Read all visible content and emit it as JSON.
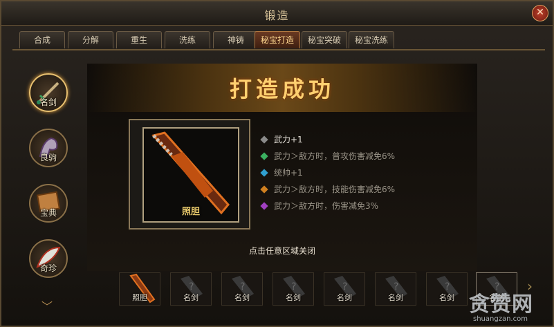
{
  "window": {
    "title": "锻造",
    "close_glyph": "✕"
  },
  "tabs": [
    {
      "label": "合成",
      "active": false
    },
    {
      "label": "分解",
      "active": false
    },
    {
      "label": "重生",
      "active": false
    },
    {
      "label": "洗练",
      "active": false
    },
    {
      "label": "神铸",
      "active": false
    },
    {
      "label": "秘宝打造",
      "active": true
    },
    {
      "label": "秘宝突破",
      "active": false
    },
    {
      "label": "秘宝洗练",
      "active": false
    }
  ],
  "sidebar": {
    "items": [
      {
        "label": "名剑",
        "icon": "sword-icon",
        "active": true
      },
      {
        "label": "良驹",
        "icon": "horse-icon",
        "active": false
      },
      {
        "label": "宝典",
        "icon": "book-icon",
        "active": false
      },
      {
        "label": "奇珍",
        "icon": "feather-icon",
        "active": false
      }
    ]
  },
  "result": {
    "banner": "打造成功",
    "item_name": "照胆",
    "stats": [
      {
        "text": "武力+1",
        "gem_color": "#8a8a8a",
        "bright": true
      },
      {
        "text": "武力＞敌方时，普攻伤害减免6%",
        "gem_color": "#3ab060",
        "bright": false
      },
      {
        "text": "统帅+1",
        "gem_color": "#30a0d0",
        "bright": false
      },
      {
        "text": "武力＞敌方时，技能伤害减免6%",
        "gem_color": "#d08020",
        "bright": false
      },
      {
        "text": "武力＞敌方时，伤害减免3%",
        "gem_color": "#a040c0",
        "bright": false
      }
    ],
    "close_hint": "点击任意区域关闭"
  },
  "slots": [
    {
      "label": "照胆"
    },
    {
      "label": "名剑"
    },
    {
      "label": "名剑"
    },
    {
      "label": "名剑"
    },
    {
      "label": "名剑"
    },
    {
      "label": "名剑"
    },
    {
      "label": "名剑"
    },
    {
      "label": "名剑"
    }
  ],
  "watermark": {
    "logo": "贪赞网",
    "url": "shuangzan.com"
  },
  "colors": {
    "accent": "#ffd070",
    "frame": "#8a7858"
  }
}
